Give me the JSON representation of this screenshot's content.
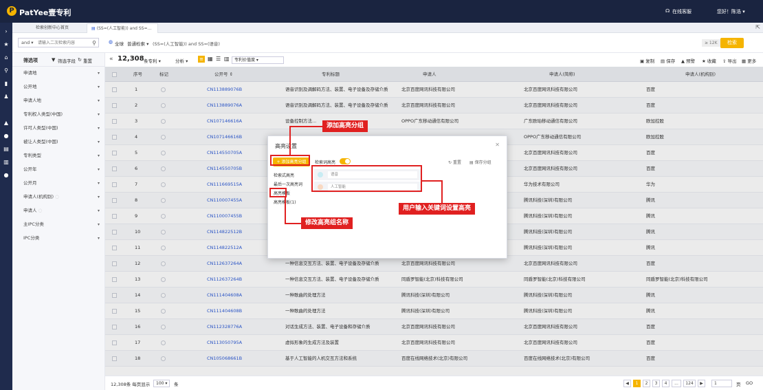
{
  "app": {
    "logo_text": "PatYee壹专利",
    "logo_glyph": "P",
    "online_service": "在线客服",
    "greeting": "您好！陈浩 ▾"
  },
  "tabs": [
    {
      "label": "检索创新中心首页"
    },
    {
      "label": "(SS=(人工智能)) and SS=... ✕"
    }
  ],
  "search": {
    "scope": "and ▾",
    "placeholder": "请输入二次检索内容",
    "scope2": "全球",
    "mode": "普通检索 ▾",
    "query": "(SS=(人工智能)) and SS=(语音)",
    "count_hint": "≥ 12K",
    "search_button": "检索"
  },
  "sidebar": {
    "header": "筛选项",
    "filter_field": "筛选字段",
    "reset": "重置",
    "items": [
      {
        "label": "申请地"
      },
      {
        "label": "公开地"
      },
      {
        "label": "申请人地"
      },
      {
        "label": "专利权人类型(中国)"
      },
      {
        "label": "许可人类型(中国)"
      },
      {
        "label": "被让人类型(中国)"
      },
      {
        "label": "专利类型"
      },
      {
        "label": "公开年"
      },
      {
        "label": "公开月"
      },
      {
        "label": "申请人(机构别)"
      },
      {
        "label": "申请人"
      },
      {
        "label": "主IPC分类"
      },
      {
        "label": "IPC分类"
      }
    ]
  },
  "toolbar": {
    "count": "12,308",
    "unit": "条专利 ▾",
    "analyze": "分析 ▾",
    "value": "专利价值度 ▾",
    "copy": "复制",
    "save": "保存",
    "alert": "预警",
    "fav": "收藏",
    "export": "导出",
    "more": "更多"
  },
  "table": {
    "headers": [
      "序号",
      "标记",
      "公开号 ⇕",
      "专利标题",
      "申请人",
      "申请人(简称)",
      "申请人(机构别)"
    ],
    "rows": [
      {
        "no": "1",
        "pub": "CN113889076B",
        "title": "语音识别及调解码方法、装置、电子设备及存储介质",
        "applicant": "北京百度网讯科技有限公司",
        "short": "北京百度网讯科技有限公司",
        "org": "百度"
      },
      {
        "no": "2",
        "pub": "CN113889076A",
        "title": "语音识别及调解码方法、装置、电子设备及存储介质",
        "applicant": "北京百度网讯科技有限公司",
        "short": "北京百度网讯科技有限公司",
        "org": "百度"
      },
      {
        "no": "3",
        "pub": "CN107146616A",
        "title": "设备控制方法...",
        "applicant": "OPPO广东移动通信有限公司",
        "short": "广东欧珀移动通信有限公司",
        "org": "欧加控股"
      },
      {
        "no": "4",
        "pub": "CN107146616B",
        "title": "",
        "applicant": "",
        "short": "OPPO广东移动通信有限公司",
        "org": "欧加控股"
      },
      {
        "no": "5",
        "pub": "CN114550705A",
        "title": "",
        "applicant": "",
        "short": "北京百度网讯科技有限公司",
        "org": "百度"
      },
      {
        "no": "6",
        "pub": "CN114550705B",
        "title": "",
        "applicant": "",
        "short": "北京百度网讯科技有限公司",
        "org": "百度"
      },
      {
        "no": "7",
        "pub": "CN111669515A",
        "title": "",
        "applicant": "",
        "short": "华为技术有限公司",
        "org": "华为"
      },
      {
        "no": "8",
        "pub": "CN110007455A",
        "title": "",
        "applicant": "",
        "short": "腾讯科技(深圳)有限公司",
        "org": "腾讯"
      },
      {
        "no": "9",
        "pub": "CN110007455B",
        "title": "",
        "applicant": "",
        "short": "腾讯科技(深圳)有限公司",
        "org": "腾讯"
      },
      {
        "no": "10",
        "pub": "CN114822512B",
        "title": "",
        "applicant": "",
        "short": "腾讯科技(深圳)有限公司",
        "org": "腾讯"
      },
      {
        "no": "11",
        "pub": "CN114822512A",
        "title": "",
        "applicant": "",
        "short": "腾讯科技(深圳)有限公司",
        "org": "腾讯"
      },
      {
        "no": "12",
        "pub": "CN112637264A",
        "title": "一种信息交互方法、装置、电子设备及存储介质",
        "applicant": "北京百度网讯科技有限公司",
        "short": "北京百度网讯科技有限公司",
        "org": "百度"
      },
      {
        "no": "13",
        "pub": "CN112637264B",
        "title": "一种信息交互方法、装置、电子设备及存储介质",
        "applicant": "同盾罗智能(北京)科技有限公司",
        "short": "同盾罗智能(北京)科技有限公司",
        "org": "同盾罗智能(北京)科技有限公司"
      },
      {
        "no": "14",
        "pub": "CN111404608A",
        "title": "一种歌曲的处理方法",
        "applicant": "腾讯科技(深圳)有限公司",
        "short": "腾讯科技(深圳)有限公司",
        "org": "腾讯"
      },
      {
        "no": "15",
        "pub": "CN111404608B",
        "title": "一种歌曲的处理方法",
        "applicant": "腾讯科技(深圳)有限公司",
        "short": "腾讯科技(深圳)有限公司",
        "org": "腾讯"
      },
      {
        "no": "16",
        "pub": "CN112328776A",
        "title": "对话生成方法、装置、电子设备和存储介质",
        "applicant": "北京百度网讯科技有限公司",
        "short": "北京百度网讯科技有限公司",
        "org": "百度"
      },
      {
        "no": "17",
        "pub": "CN113050795A",
        "title": "虚拟形象的生成方法及装置",
        "applicant": "北京百度网讯科技有限公司",
        "short": "北京百度网讯科技有限公司",
        "org": "百度"
      },
      {
        "no": "18",
        "pub": "CN105068661B",
        "title": "基于人工智能的人机交互方法和系统",
        "applicant": "百度在线网络技术(北京)有限公司",
        "short": "百度在线网络技术(北京)有限公司",
        "org": "百度"
      }
    ]
  },
  "footer": {
    "total": "12,308条 每页显示",
    "per_page": "100 ▾",
    "pages": [
      "1",
      "2",
      "3",
      "4",
      "...",
      "124"
    ],
    "next": "▶",
    "goto_value": "1",
    "page_label": "页",
    "go": "GO"
  },
  "modal": {
    "title": "高亮设置",
    "close": "✕",
    "add_group": "+ 添加高亮分组",
    "toggle_label": "检索词高亮",
    "reset": "重置",
    "save_group": "保存分组",
    "groups": [
      {
        "label": "检索式高亮"
      },
      {
        "label": "最后一次高亮词"
      },
      {
        "label": "高亮模板"
      },
      {
        "label": "高亮模板(1)"
      }
    ],
    "keywords": [
      {
        "text": "语音",
        "color": "#c8ecf3"
      },
      {
        "text": "人工智能",
        "color": "#f9d9c2"
      }
    ]
  },
  "callouts": {
    "add": "添加高亮分组",
    "input": "用户输入关键词设置高亮",
    "rename": "修改高亮组名称"
  },
  "colors": {
    "accent": "#f5b400",
    "nav": "#1a2440",
    "link": "#2d5bd6",
    "annotation": "#e02020"
  }
}
